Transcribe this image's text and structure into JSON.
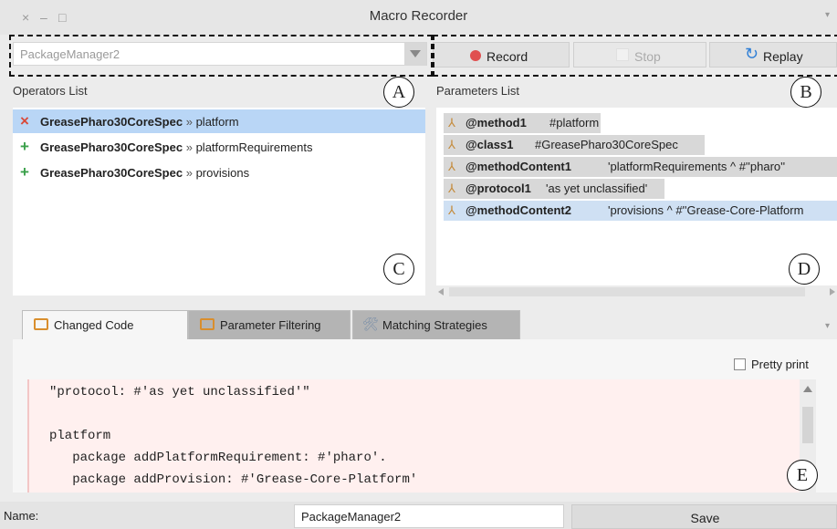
{
  "window": {
    "title": "Macro Recorder",
    "controls": [
      "×",
      "–",
      "□"
    ],
    "menu_glyph": "▾"
  },
  "toolbar": {
    "package_value": "PackageManager2",
    "record_label": "Record",
    "stop_label": "Stop",
    "replay_label": "Replay",
    "replay_glyph": "↻"
  },
  "operators": {
    "label": "Operators List",
    "items": [
      {
        "icon": "×",
        "icon_color": "#d94a3a",
        "cls": "GreasePharo30CoreSpec",
        "sep": "»",
        "method": "platform",
        "selected": true
      },
      {
        "icon": "+",
        "icon_color": "#3aa04a",
        "cls": "GreasePharo30CoreSpec",
        "sep": "»",
        "method": "platformRequirements",
        "selected": false
      },
      {
        "icon": "+",
        "icon_color": "#3aa04a",
        "cls": "GreasePharo30CoreSpec",
        "sep": "»",
        "method": "provisions",
        "selected": false
      }
    ]
  },
  "parameters": {
    "label": "Parameters List",
    "icon_glyph": "⅄",
    "items": [
      {
        "name": "@method1",
        "value": "#platform"
      },
      {
        "name": "@class1",
        "value": "#GreasePharo30CoreSpec"
      },
      {
        "name": "@methodContent1",
        "value": "'platformRequirements  ^ #''pharo''"
      },
      {
        "name": "@protocol1",
        "value": "'as yet unclassified'"
      },
      {
        "name": "@methodContent2",
        "value": "'provisions  ^ #''Grease-Core-Platform"
      }
    ]
  },
  "callouts": {
    "a": "A",
    "b": "B",
    "c": "C",
    "d": "D",
    "e": "E"
  },
  "tabs": {
    "changed_code": "Changed Code",
    "parameter_filtering": "Parameter Filtering",
    "matching_strategies": "Matching Strategies",
    "tool_glyph": "🛠",
    "menu_glyph": "▾"
  },
  "code": {
    "pretty_print": "Pretty print",
    "lines": [
      "\"protocol: #'as yet unclassified'\"",
      "",
      "platform",
      "   package addPlatformRequirement: #'pharo'.",
      "   package addProvision: #'Grease-Core-Platform'"
    ]
  },
  "footer": {
    "name_label": "Name:",
    "name_value": "PackageManager2",
    "save_label": "Save"
  }
}
